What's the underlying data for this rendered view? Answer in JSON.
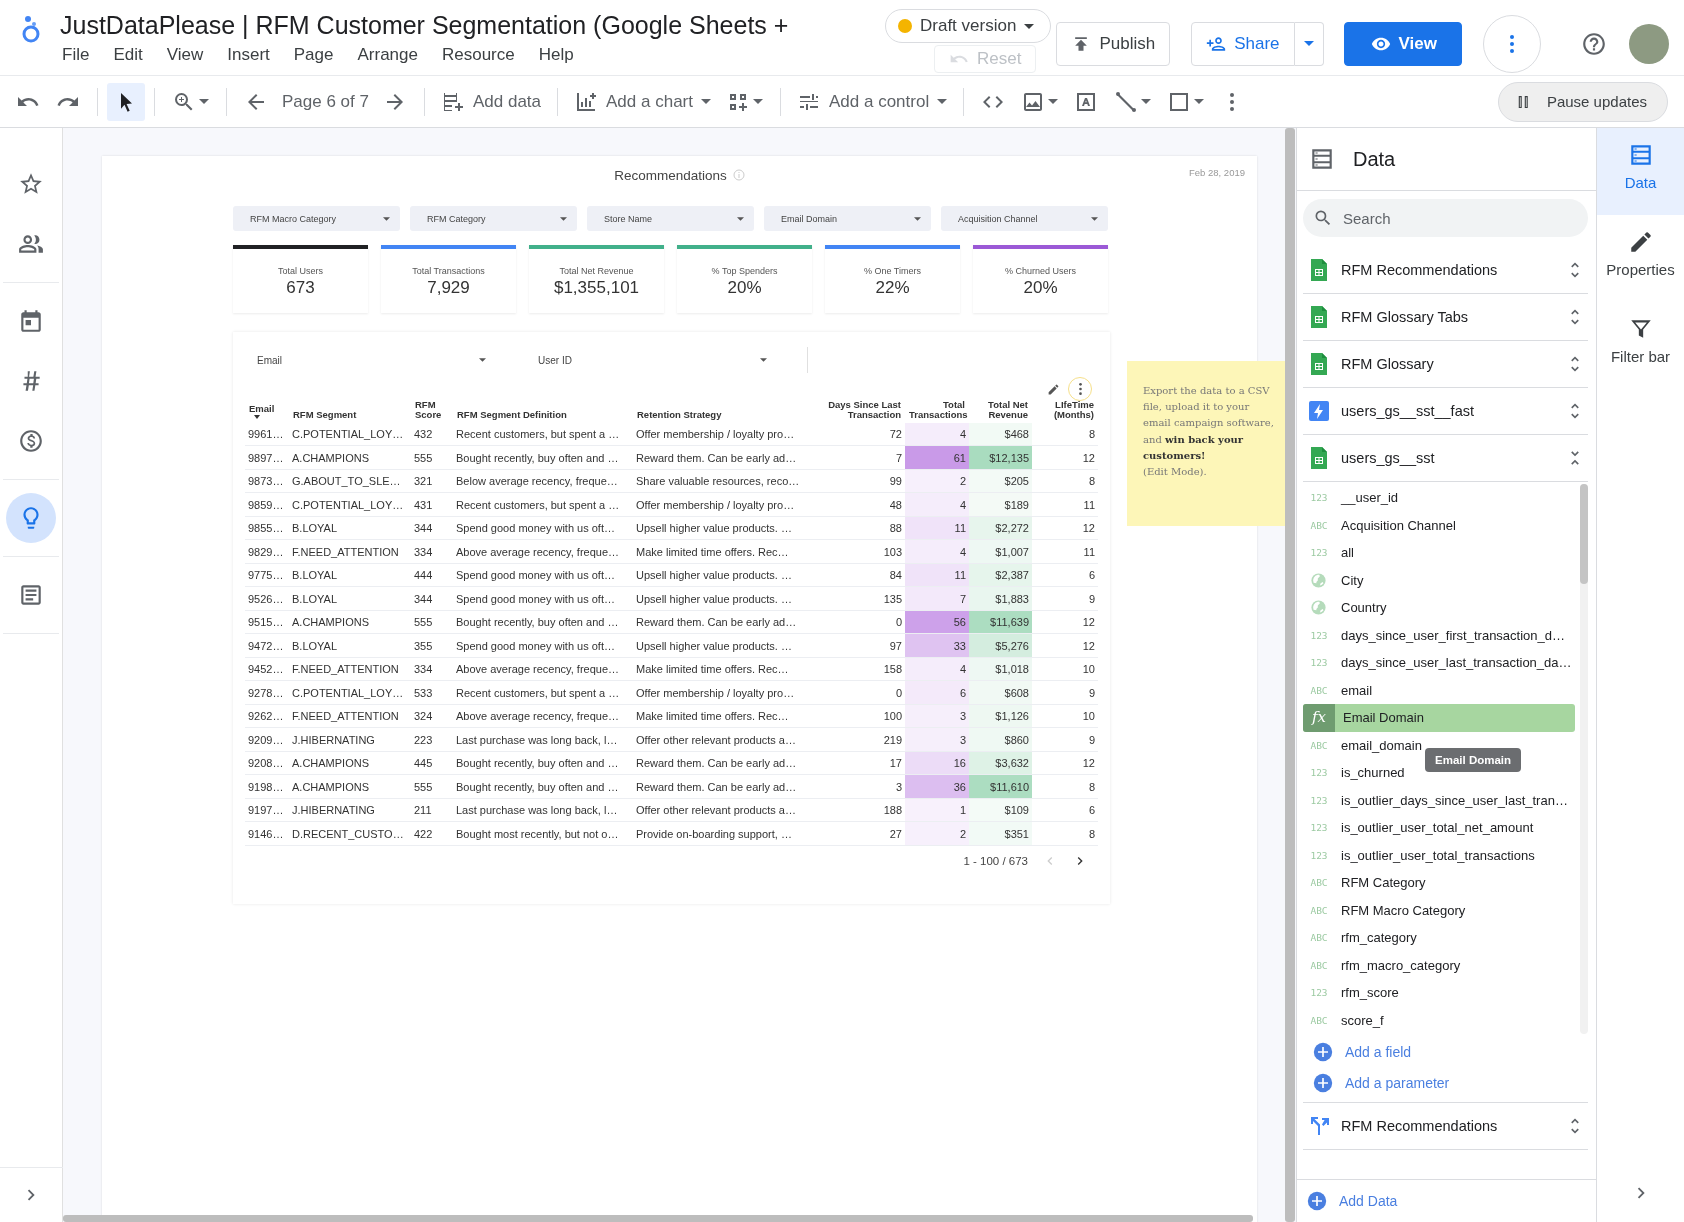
{
  "header": {
    "title": "JustDataPlease | RFM Customer Segmentation (Google Sheets +",
    "menu": [
      "File",
      "Edit",
      "View",
      "Insert",
      "Page",
      "Arrange",
      "Resource",
      "Help"
    ],
    "draft": "Draft version",
    "reset": {
      "label": "Reset",
      "disabled": true
    },
    "publish": "Publish",
    "share": "Share",
    "view": "View"
  },
  "toolbar": {
    "pointer_selected": true,
    "page_label": "Page 6 of 7",
    "add_data": "Add data",
    "add_chart": "Add a chart",
    "add_control": "Add a control",
    "pause": "Pause updates"
  },
  "rail": {
    "groups": [
      [
        {
          "kind": "star",
          "selected": false
        },
        {
          "kind": "people",
          "selected": false
        }
      ],
      [
        {
          "kind": "calendar",
          "selected": false
        },
        {
          "kind": "hash",
          "selected": false
        },
        {
          "kind": "dollar",
          "selected": false
        }
      ],
      [
        {
          "kind": "bulb",
          "selected": true
        }
      ],
      [
        {
          "kind": "doc",
          "selected": false
        }
      ]
    ]
  },
  "report": {
    "title": "Recommendations",
    "date": "Feb 28, 2019",
    "filters": [
      "RFM Macro Category",
      "RFM Category",
      "Store Name",
      "Email Domain",
      "Acquisition Channel"
    ],
    "scorecards": [
      {
        "label": "Total Users",
        "value": "673",
        "color": "#202124"
      },
      {
        "label": "Total Transactions",
        "value": "7,929",
        "color": "#4285f4"
      },
      {
        "label": "Total Net Revenue",
        "value": "$1,355,101",
        "color": "#41b08a"
      },
      {
        "label": "% Top Spenders",
        "value": "20%",
        "color": "#41b08a"
      },
      {
        "label": "% One Timers",
        "value": "22%",
        "color": "#4285f4"
      },
      {
        "label": "% Churned Users",
        "value": "20%",
        "color": "#9b59d6"
      }
    ],
    "table": {
      "controls": [
        "Email",
        "User ID"
      ],
      "columns": [
        {
          "label": "Email",
          "kind": "text",
          "sorted": true
        },
        {
          "label": "RFM Segment",
          "kind": "text",
          "sorted": false
        },
        {
          "label": "RFM Score",
          "kind": "text",
          "sorted": false
        },
        {
          "label": "RFM Segment Definition",
          "kind": "text",
          "sorted": false
        },
        {
          "label": "Retention Strategy",
          "kind": "text",
          "sorted": false
        },
        {
          "label": "Days Since Last Transaction",
          "kind": "number",
          "sorted": false
        },
        {
          "label": "Total Transactions",
          "kind": "number",
          "sorted": false,
          "color": "#c99ae8"
        },
        {
          "label": "Total Net Revenue",
          "kind": "number",
          "sorted": false,
          "color": "#a9dcbf"
        },
        {
          "label": "LIfeTime (Months)",
          "kind": "number",
          "sorted": false
        }
      ],
      "rows": [
        [
          "9961…",
          "C.POTENTIAL_LOY…",
          "432",
          "Recent customers, but spent a …",
          "Offer membership / loyalty pro…",
          "72",
          "4",
          "$468",
          "8"
        ],
        [
          "9897…",
          "A.CHAMPIONS",
          "555",
          "Bought recently, buy often and …",
          "Reward them. Can be early ad…",
          "7",
          "61",
          "$12,135",
          "12"
        ],
        [
          "9873…",
          "G.ABOUT_TO_SLE…",
          "321",
          "Below average recency, freque…",
          "Share valuable resources, reco…",
          "99",
          "2",
          "$205",
          "8"
        ],
        [
          "9859…",
          "C.POTENTIAL_LOY…",
          "431",
          "Recent customers, but spent a …",
          "Offer membership / loyalty pro…",
          "48",
          "4",
          "$189",
          "11"
        ],
        [
          "9855…",
          "B.LOYAL",
          "344",
          "Spend good money with us oft…",
          "Upsell higher value products. …",
          "88",
          "11",
          "$2,272",
          "12"
        ],
        [
          "9829…",
          "F.NEED_ATTENTION",
          "334",
          "Above average recency, freque…",
          "Make limited time offers. Rec…",
          "103",
          "4",
          "$1,007",
          "11"
        ],
        [
          "9775…",
          "B.LOYAL",
          "444",
          "Spend good money with us oft…",
          "Upsell higher value products. …",
          "84",
          "11",
          "$2,387",
          "6"
        ],
        [
          "9526…",
          "B.LOYAL",
          "344",
          "Spend good money with us oft…",
          "Upsell higher value products. …",
          "135",
          "7",
          "$1,883",
          "9"
        ],
        [
          "9515…",
          "A.CHAMPIONS",
          "555",
          "Bought recently, buy often and …",
          "Reward them. Can be early ad…",
          "0",
          "56",
          "$11,639",
          "12"
        ],
        [
          "9472…",
          "B.LOYAL",
          "355",
          "Spend good money with us oft…",
          "Upsell higher value products. …",
          "97",
          "33",
          "$5,276",
          "12"
        ],
        [
          "9452…",
          "F.NEED_ATTENTION",
          "334",
          "Above average recency, freque…",
          "Make limited time offers. Rec…",
          "158",
          "4",
          "$1,018",
          "10"
        ],
        [
          "9278…",
          "C.POTENTIAL_LOY…",
          "533",
          "Recent customers, but spent a …",
          "Offer membership / loyalty pro…",
          "0",
          "6",
          "$608",
          "9"
        ],
        [
          "9262…",
          "F.NEED_ATTENTION",
          "324",
          "Above average recency, freque…",
          "Make limited time offers. Rec…",
          "100",
          "3",
          "$1,126",
          "10"
        ],
        [
          "9209…",
          "J.HIBERNATING",
          "223",
          "Last purchase was long back, l…",
          "Offer other relevant products a…",
          "219",
          "3",
          "$860",
          "9"
        ],
        [
          "9208…",
          "A.CHAMPIONS",
          "445",
          "Bought recently, buy often and …",
          "Reward them. Can be early ad…",
          "17",
          "16",
          "$3,632",
          "12"
        ],
        [
          "9198…",
          "A.CHAMPIONS",
          "555",
          "Bought recently, buy often and …",
          "Reward them. Can be early ad…",
          "3",
          "36",
          "$11,610",
          "8"
        ],
        [
          "9197…",
          "J.HIBERNATING",
          "211",
          "Last purchase was long back, l…",
          "Offer other relevant products a…",
          "188",
          "1",
          "$109",
          "6"
        ],
        [
          "9146…",
          "D.RECENT_CUSTO…",
          "422",
          "Bought most recently, but not o…",
          "Provide on-boarding support, …",
          "27",
          "2",
          "$351",
          "8"
        ]
      ],
      "pagination": "1 - 100 / 673"
    },
    "note": "Export the data to a CSV file, upload it to your email campaign software, and **win back your customers!**",
    "note_hint": "(Edit Mode)."
  },
  "data_panel": {
    "title": "Data",
    "search_placeholder": "Search",
    "sources": [
      {
        "name": "RFM Recommendations",
        "kind": "sheets",
        "expanded": false
      },
      {
        "name": "RFM Glossary Tabs",
        "kind": "sheets",
        "expanded": false
      },
      {
        "name": "RFM Glossary",
        "kind": "sheets",
        "expanded": false
      },
      {
        "name": "users_gs__sst__fast",
        "kind": "extract",
        "expanded": false
      },
      {
        "name": "users_gs__sst",
        "kind": "sheets",
        "expanded": true
      }
    ],
    "fields": [
      {
        "kind": "number",
        "badge": "123",
        "name": "__user_id",
        "selected": false
      },
      {
        "kind": "text",
        "badge": "ABC",
        "name": "Acquisition Channel",
        "selected": false
      },
      {
        "kind": "number",
        "badge": "123",
        "name": "all",
        "selected": false
      },
      {
        "kind": "geo",
        "name": "City",
        "selected": false
      },
      {
        "kind": "geo",
        "name": "Country",
        "selected": false
      },
      {
        "kind": "number",
        "badge": "123",
        "name": "days_since_user_first_transaction_d…",
        "selected": false
      },
      {
        "kind": "number",
        "badge": "123",
        "name": "days_since_user_last_transaction_da…",
        "selected": false
      },
      {
        "kind": "text",
        "badge": "ABC",
        "name": "email",
        "selected": false
      },
      {
        "kind": "calc",
        "badge": "fx",
        "name": "Email Domain",
        "selected": true
      },
      {
        "kind": "text",
        "badge": "ABC",
        "name": "email_domain",
        "selected": false
      },
      {
        "kind": "number",
        "badge": "123",
        "name": "is_churned",
        "selected": false
      },
      {
        "kind": "number",
        "badge": "123",
        "name": "is_outlier_days_since_user_last_tran…",
        "selected": false
      },
      {
        "kind": "number",
        "badge": "123",
        "name": "is_outlier_user_total_net_amount",
        "selected": false
      },
      {
        "kind": "number",
        "badge": "123",
        "name": "is_outlier_user_total_transactions",
        "selected": false
      },
      {
        "kind": "text",
        "badge": "ABC",
        "name": "RFM Category",
        "selected": false
      },
      {
        "kind": "text",
        "badge": "ABC",
        "name": "RFM Macro Category",
        "selected": false
      },
      {
        "kind": "text",
        "badge": "ABC",
        "name": "rfm_category",
        "selected": false
      },
      {
        "kind": "text",
        "badge": "ABC",
        "name": "rfm_macro_category",
        "selected": false
      },
      {
        "kind": "number",
        "badge": "123",
        "name": "rfm_score",
        "selected": false
      },
      {
        "kind": "text",
        "badge": "ABC",
        "name": "score_f",
        "selected": false
      }
    ],
    "tooltip": "Email Domain",
    "add_field": "Add a field",
    "add_parameter": "Add a parameter",
    "more_sources": [
      {
        "name": "RFM Recommendations",
        "kind": "blend",
        "expanded": false
      }
    ],
    "add_data": "Add Data"
  },
  "right_rail": [
    {
      "label": "Data",
      "kind": "data",
      "selected": true
    },
    {
      "label": "Properties",
      "kind": "properties",
      "selected": false
    },
    {
      "label": "Filter bar",
      "kind": "filter",
      "selected": false
    }
  ]
}
